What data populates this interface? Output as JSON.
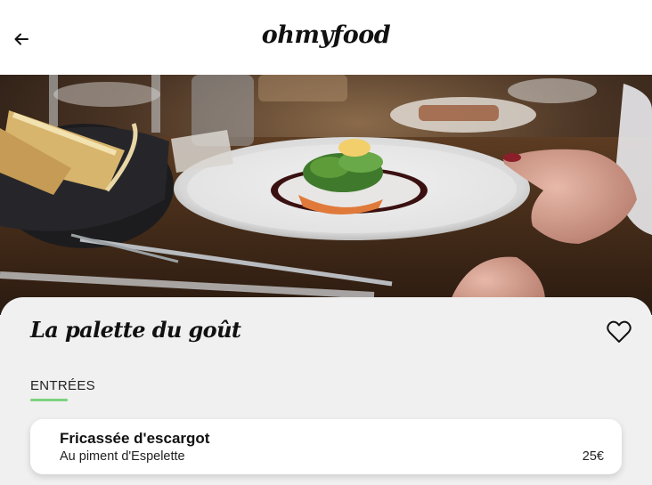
{
  "header": {
    "logo": "ohmyfood",
    "back_icon": "arrow-left-icon"
  },
  "hero": {
    "image": "restaurant-dish-photo"
  },
  "restaurant": {
    "name": "La palette du goût",
    "favorite_icon": "heart-outline-icon"
  },
  "menu": {
    "section_title": "ENTRÉES",
    "accent_color": "#7ed37e",
    "items": [
      {
        "name": "Fricassée d'escargot",
        "description": "Au piment d'Espelette",
        "price": "25€"
      }
    ]
  }
}
